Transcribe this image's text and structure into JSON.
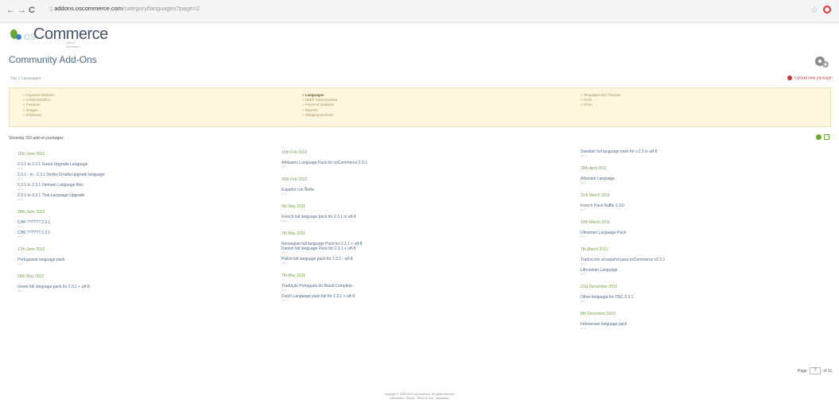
{
  "browser": {
    "back": "←",
    "forward": "→",
    "reload": "C",
    "url_host": "addons.oscommerce.com",
    "url_path": "/category/languages?page=2"
  },
  "header": {
    "logo_os": "os",
    "logo_text": "Commerce",
    "logo_sub": "online merchant",
    "page_title": "Community Add-Ons"
  },
  "breadcrumb": "Top » Languages",
  "upload_label": "Upload new package",
  "categories": [
    [
      "» Payment Modules",
      "» Credit Modules",
      "» Features",
      "» Images",
      "» Infoboxes"
    ],
    [
      "» Languages",
      "» Order Total Modules",
      "» Payment Modules",
      "» Reports",
      "» Shipping Modules"
    ],
    [
      "» Templates and Themes",
      "» Tools",
      "» Other"
    ]
  ],
  "showing": "Showing 153 add-on packages.",
  "columns": [
    [
      {
        "type": "date",
        "text": "15th June 2012"
      },
      {
        "type": "title",
        "text": "2.3.1 to 2.3.1 Greek Upgrade Language"
      },
      {
        "type": "meta",
        "text": "v2.3"
      },
      {
        "type": "title",
        "text": "2.3.1 - to - 2.3.1 Serbo-Croatia upgrade language"
      },
      {
        "type": "meta",
        "text": "v2.3"
      },
      {
        "type": "title",
        "text": "2.3.1 to 2.3.1 Vietnam Language files"
      },
      {
        "type": "meta",
        "text": "v2.3"
      },
      {
        "type": "title",
        "text": "2.3.1 to 2.3.1 Thai Language Upgrade"
      },
      {
        "type": "meta",
        "text": "v2.3"
      },
      {
        "type": "date",
        "text": "28th June 2012"
      },
      {
        "type": "title",
        "text": "CHK ?????? 2.3.1"
      },
      {
        "type": "meta",
        "text": "v2.3"
      },
      {
        "type": "title",
        "text": "CHK ?????? 2.3.1"
      },
      {
        "type": "meta",
        "text": "v2.3"
      },
      {
        "type": "date",
        "text": "17th June 2012"
      },
      {
        "type": "title",
        "text": "Portuguese language pack"
      },
      {
        "type": "meta",
        "text": "v2.3"
      },
      {
        "type": "date",
        "text": "29th May 2012"
      },
      {
        "type": "title",
        "text": "Greek full language pack for 2.3.1 + utf-8"
      },
      {
        "type": "meta",
        "text": "v2.3"
      }
    ],
    [
      {
        "type": "date",
        "text": "13th Feb 2012"
      },
      {
        "type": "title",
        "text": "Afrikaans Language Pack for osCommerce 2.3.1"
      },
      {
        "type": "meta",
        "text": "v2.3"
      },
      {
        "type": "date",
        "text": "30th Feb 2012"
      },
      {
        "type": "title",
        "text": "Español con Ñoña"
      },
      {
        "type": "meta",
        "text": "v2.3"
      },
      {
        "type": "date",
        "text": "9th May 2011"
      },
      {
        "type": "title",
        "text": "French full language pack for 2.3.1 in utf-8"
      },
      {
        "type": "meta",
        "text": "v2.3"
      },
      {
        "type": "date",
        "text": "7th May 2011"
      },
      {
        "type": "title",
        "text": "Norwegian full language Pack for 2.3.1 + utf-8"
      },
      {
        "type": "title",
        "text": "Danish full language Pack for 2.3.1 + utf-8"
      },
      {
        "type": "meta",
        "text": "v2.3"
      },
      {
        "type": "title",
        "text": "Polish full language pack for 2.3.1 - utf-8"
      },
      {
        "type": "meta",
        "text": "v2.3"
      },
      {
        "type": "date",
        "text": "7th May 2011"
      },
      {
        "type": "title",
        "text": "Tradução Português do Brasil Completa"
      },
      {
        "type": "meta",
        "text": "v2.3"
      },
      {
        "type": "title",
        "text": "Dutch Language pack full for 2.3.1 + utf-8"
      },
      {
        "type": "meta",
        "text": "v2.3"
      }
    ],
    [
      {
        "type": "title",
        "text": "Swedish full language pack for v.2.3 in utf-8"
      },
      {
        "type": "meta",
        "text": "v2.3"
      },
      {
        "type": "date",
        "text": "18th April 2011"
      },
      {
        "type": "title",
        "text": "Albanian Language"
      },
      {
        "type": "meta",
        "text": "v2.3"
      },
      {
        "type": "date",
        "text": "11th March 2011"
      },
      {
        "type": "title",
        "text": "French Pack Ruffle 2.3.0"
      },
      {
        "type": "meta",
        "text": "v2.3"
      },
      {
        "type": "date",
        "text": "10th March 2011"
      },
      {
        "type": "title",
        "text": "Ukrainian Language Pack"
      },
      {
        "type": "meta",
        "text": "v2.3"
      },
      {
        "type": "date",
        "text": "7th March 2011"
      },
      {
        "type": "title",
        "text": "Traducción al español para osCommerce v2.3.1"
      },
      {
        "type": "meta",
        "text": "v2.3"
      },
      {
        "type": "title",
        "text": "Lithuanian Language"
      },
      {
        "type": "meta",
        "text": "v2.3"
      },
      {
        "type": "date",
        "text": "21st December 2010"
      },
      {
        "type": "title",
        "text": "Other language for OSC 2.3.1"
      },
      {
        "type": "meta",
        "text": "v2.3"
      },
      {
        "type": "date",
        "text": "8th December 2010"
      },
      {
        "type": "title",
        "text": "Indonesian language pack"
      },
      {
        "type": "meta",
        "text": "v2.3"
      }
    ]
  ],
  "pager": {
    "prefix": "Page",
    "current": "7",
    "suffix": "of 11"
  },
  "footer": {
    "line1": "Copyright © 2000-2012 osCommerce. All rights reserved.",
    "line2": "Information · Report · Terms of Use · Impressum"
  }
}
